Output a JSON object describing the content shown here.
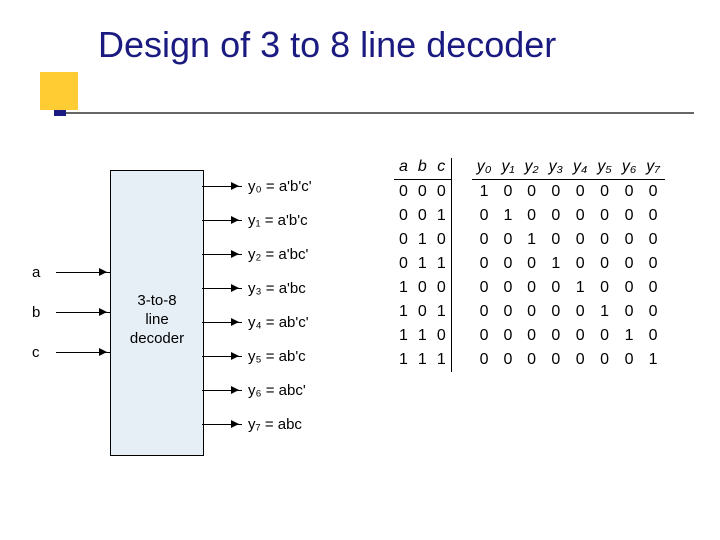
{
  "title": "Design of 3 to 8 line decoder",
  "decoder_label_line1": "3-to-8",
  "decoder_label_line2": "line",
  "decoder_label_line3": "decoder",
  "inputs": {
    "a": "a",
    "b": "b",
    "c": "c"
  },
  "outputs": [
    {
      "name": "y0",
      "expr": "y₀ = a'b'c'"
    },
    {
      "name": "y1",
      "expr": "y₁ = a'b'c"
    },
    {
      "name": "y2",
      "expr": "y₂ = a'bc'"
    },
    {
      "name": "y3",
      "expr": "y₃ = a'bc"
    },
    {
      "name": "y4",
      "expr": "y₄ = ab'c'"
    },
    {
      "name": "y5",
      "expr": "y₅ = ab'c"
    },
    {
      "name": "y6",
      "expr": "y₆ = abc'"
    },
    {
      "name": "y7",
      "expr": "y₇ = abc"
    }
  ],
  "tt_head": {
    "a": "a",
    "b": "b",
    "c": "c",
    "y0": "y₀",
    "y1": "y₁",
    "y2": "y₂",
    "y3": "y₃",
    "y4": "y₄",
    "y5": "y₅",
    "y6": "y₆",
    "y7": "y₇"
  },
  "chart_data": {
    "type": "table",
    "title": "3-to-8 line decoder truth table",
    "columns": [
      "a",
      "b",
      "c",
      "y0",
      "y1",
      "y2",
      "y3",
      "y4",
      "y5",
      "y6",
      "y7"
    ],
    "rows": [
      {
        "a": 0,
        "b": 0,
        "c": 0,
        "y0": 1,
        "y1": 0,
        "y2": 0,
        "y3": 0,
        "y4": 0,
        "y5": 0,
        "y6": 0,
        "y7": 0
      },
      {
        "a": 0,
        "b": 0,
        "c": 1,
        "y0": 0,
        "y1": 1,
        "y2": 0,
        "y3": 0,
        "y4": 0,
        "y5": 0,
        "y6": 0,
        "y7": 0
      },
      {
        "a": 0,
        "b": 1,
        "c": 0,
        "y0": 0,
        "y1": 0,
        "y2": 1,
        "y3": 0,
        "y4": 0,
        "y5": 0,
        "y6": 0,
        "y7": 0
      },
      {
        "a": 0,
        "b": 1,
        "c": 1,
        "y0": 0,
        "y1": 0,
        "y2": 0,
        "y3": 1,
        "y4": 0,
        "y5": 0,
        "y6": 0,
        "y7": 0
      },
      {
        "a": 1,
        "b": 0,
        "c": 0,
        "y0": 0,
        "y1": 0,
        "y2": 0,
        "y3": 0,
        "y4": 1,
        "y5": 0,
        "y6": 0,
        "y7": 0
      },
      {
        "a": 1,
        "b": 0,
        "c": 1,
        "y0": 0,
        "y1": 0,
        "y2": 0,
        "y3": 0,
        "y4": 0,
        "y5": 1,
        "y6": 0,
        "y7": 0
      },
      {
        "a": 1,
        "b": 1,
        "c": 0,
        "y0": 0,
        "y1": 0,
        "y2": 0,
        "y3": 0,
        "y4": 0,
        "y5": 0,
        "y6": 1,
        "y7": 0
      },
      {
        "a": 1,
        "b": 1,
        "c": 1,
        "y0": 0,
        "y1": 0,
        "y2": 0,
        "y3": 0,
        "y4": 0,
        "y5": 0,
        "y6": 0,
        "y7": 1
      }
    ]
  }
}
